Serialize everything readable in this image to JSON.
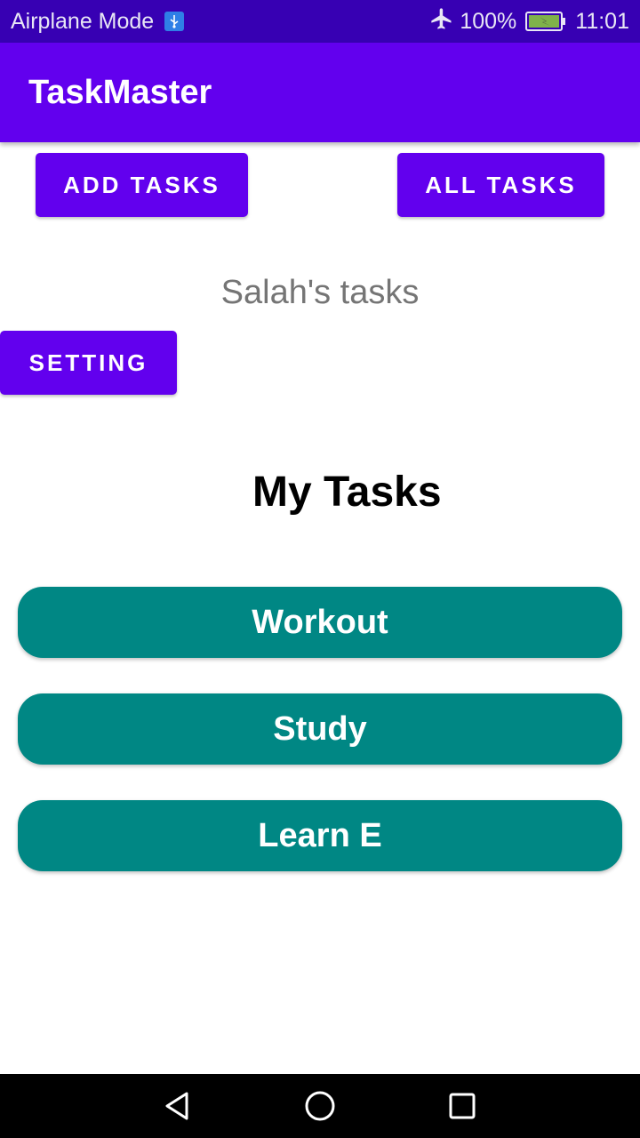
{
  "status_bar": {
    "airplane_mode_label": "Airplane Mode",
    "battery_percent": "100%",
    "time": "11:01",
    "icons": [
      "usb-icon",
      "airplane-icon",
      "battery-charging-icon"
    ]
  },
  "app_bar": {
    "title": "TaskMaster"
  },
  "buttons": {
    "add_tasks": "ADD TASKS",
    "all_tasks": "ALL TASKS",
    "setting": "SETTING"
  },
  "user_tasks_label": "Salah's tasks",
  "my_tasks_heading": "My Tasks",
  "tasks": [
    {
      "title": "Workout"
    },
    {
      "title": "Study"
    },
    {
      "title": "Learn E"
    }
  ],
  "colors": {
    "status_bar": "#3700b3",
    "primary": "#6200ee",
    "task_button": "#008784"
  },
  "nav_bar": {
    "icons": [
      "back-icon",
      "home-icon",
      "recent-apps-icon"
    ]
  }
}
